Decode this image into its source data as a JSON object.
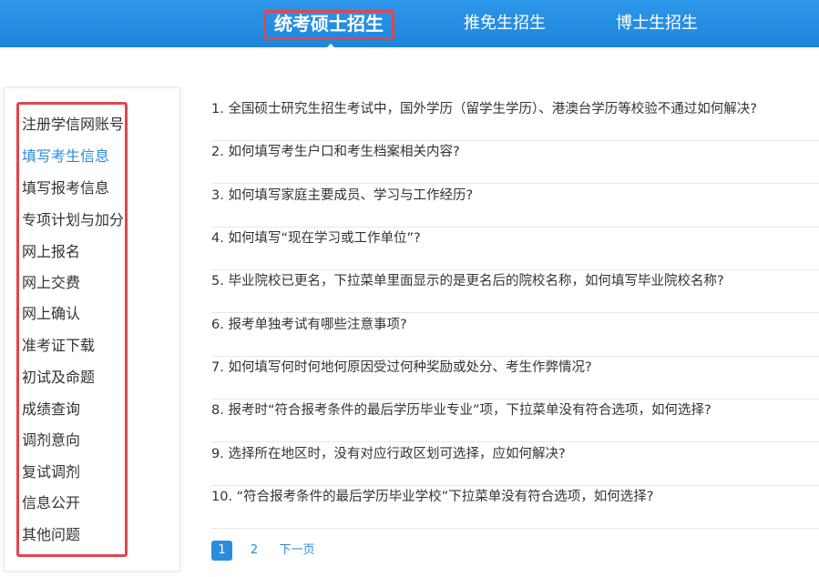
{
  "top_nav": {
    "tabs": [
      {
        "label": "统考硕士招生"
      },
      {
        "label": "推免生招生"
      },
      {
        "label": "博士生招生"
      }
    ]
  },
  "sidebar": {
    "items": [
      {
        "label": "注册学信网账号"
      },
      {
        "label": "填写考生信息"
      },
      {
        "label": "填写报考信息"
      },
      {
        "label": "专项计划与加分"
      },
      {
        "label": "网上报名"
      },
      {
        "label": "网上交费"
      },
      {
        "label": "网上确认"
      },
      {
        "label": "准考证下载"
      },
      {
        "label": "初试及命题"
      },
      {
        "label": "成绩查询"
      },
      {
        "label": "调剂意向"
      },
      {
        "label": "复试调剂"
      },
      {
        "label": "信息公开"
      },
      {
        "label": "其他问题"
      }
    ]
  },
  "questions": [
    "1. 全国硕士研究生招生考试中，国外学历（留学生学历）、港澳台学历等校验不通过如何解决?",
    "2. 如何填写考生户口和考生档案相关内容?",
    "3. 如何填写家庭主要成员、学习与工作经历?",
    "4. 如何填写“现在学习或工作单位”?",
    "5. 毕业院校已更名，下拉菜单里面显示的是更名后的院校名称，如何填写毕业院校名称?",
    "6. 报考单独考试有哪些注意事项?",
    "7. 如何填写何时何地何原因受过何种奖励或处分、考生作弊情况?",
    "8. 报考时“符合报考条件的最后学历毕业专业”项，下拉菜单没有符合选项，如何选择?",
    "9. 选择所在地区时，没有对应行政区划可选择，应如何解决?",
    "10. “符合报考条件的最后学历毕业学校”下拉菜单没有符合选项，如何选择?"
  ],
  "pagination": {
    "current": "1",
    "page2": "2",
    "next": "下一页"
  },
  "colors": {
    "nav_bg": "#1e86db",
    "accent": "#2b8bdc",
    "highlight_border": "#e0454e"
  }
}
